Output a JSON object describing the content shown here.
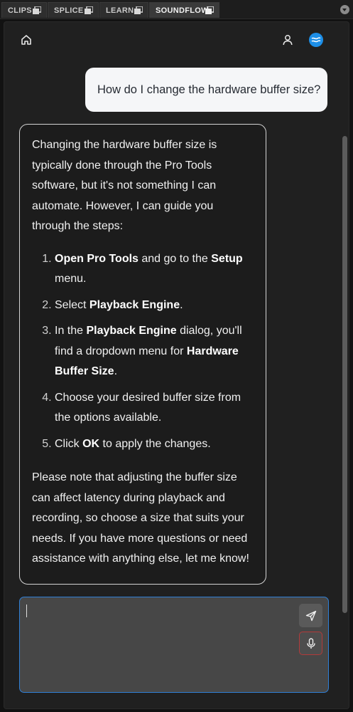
{
  "tabs": [
    {
      "label": "CLIPS",
      "active": false,
      "icon": "window-stack-icon"
    },
    {
      "label": "SPLICE",
      "active": false,
      "icon": "window-stack-icon"
    },
    {
      "label": "LEARN",
      "active": false,
      "icon": "window-stack-icon"
    },
    {
      "label": "SOUNDFLOW",
      "active": true,
      "icon": "window-stack-icon"
    }
  ],
  "header": {
    "home_icon": "home-icon",
    "user_icon": "user-icon",
    "brand_icon": "soundflow-logo-icon",
    "brand_color": "#1d8fe8"
  },
  "chat": {
    "user_message": "How do I change the hardware buffer size?",
    "reply": {
      "intro": "Changing the hardware buffer size is typically done through the Pro Tools software, but it's not something I can automate. However, I can guide you through the steps:",
      "steps": [
        {
          "bold1": "Open Pro Tools",
          "mid": " and go to the ",
          "bold2": "Setup",
          "end": " menu."
        },
        {
          "pre": "Select ",
          "bold1": "Playback Engine",
          "end": "."
        },
        {
          "pre": "In the ",
          "bold1": "Playback Engine",
          "mid": " dialog, you'll find a dropdown menu for ",
          "bold2": "Hardware Buffer Size",
          "end": "."
        },
        {
          "pre": "Choose your desired buffer size from the options available."
        },
        {
          "pre": "Click ",
          "bold1": "OK",
          "end": " to apply the changes."
        }
      ],
      "outro": "Please note that adjusting the buffer size can affect latency during playback and recording, so choose a size that suits your needs. If you have more questions or need assistance with anything else, let me know!"
    }
  },
  "composer": {
    "value": "",
    "send_icon": "send-icon",
    "mic_icon": "microphone-icon",
    "focus_color": "#2f7fd6",
    "mic_border_color": "#b33a3a"
  }
}
